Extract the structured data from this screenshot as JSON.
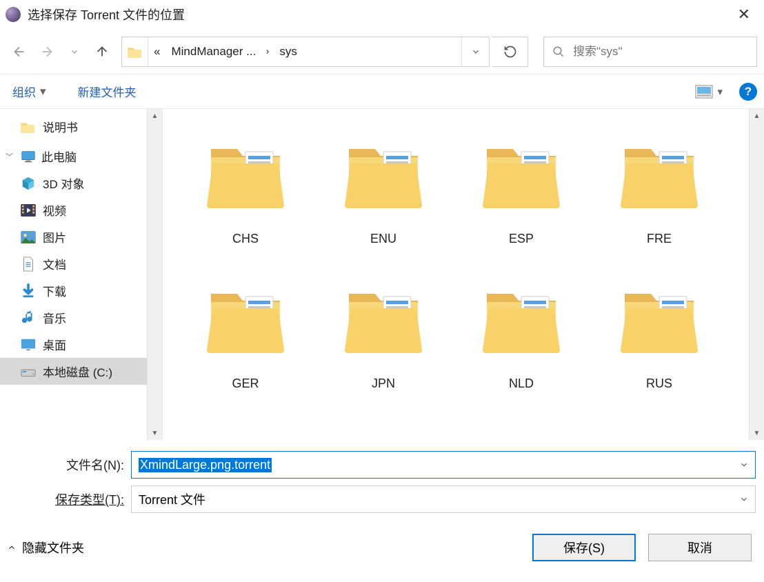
{
  "titlebar": {
    "title": "选择保存 Torrent 文件的位置"
  },
  "nav": {
    "breadcrumb": {
      "overflow": "«",
      "segments": [
        "MindManager ...",
        "sys"
      ]
    },
    "search_placeholder": "搜索\"sys\""
  },
  "toolbar": {
    "organize": "组织",
    "new_folder": "新建文件夹"
  },
  "sidebar": {
    "items": [
      {
        "label": "说明书",
        "icon": "folder",
        "indent": "child"
      },
      {
        "label": "此电脑",
        "icon": "computer",
        "indent": "section",
        "expandable": true
      },
      {
        "label": "3D 对象",
        "icon": "3d",
        "indent": "child"
      },
      {
        "label": "视频",
        "icon": "video",
        "indent": "child"
      },
      {
        "label": "图片",
        "icon": "pictures",
        "indent": "child"
      },
      {
        "label": "文档",
        "icon": "documents",
        "indent": "child"
      },
      {
        "label": "下载",
        "icon": "downloads",
        "indent": "child"
      },
      {
        "label": "音乐",
        "icon": "music",
        "indent": "child"
      },
      {
        "label": "桌面",
        "icon": "desktop",
        "indent": "child"
      },
      {
        "label": "本地磁盘 (C:)",
        "icon": "drive",
        "indent": "child",
        "selected": true
      }
    ]
  },
  "content": {
    "folders": [
      "CHS",
      "ENU",
      "ESP",
      "FRE",
      "GER",
      "JPN",
      "NLD",
      "RUS"
    ]
  },
  "form": {
    "filename_label": "文件名(N):",
    "filename_value": "XmindLarge.png.torrent",
    "type_label": "保存类型(T):",
    "type_value": "Torrent 文件"
  },
  "footer": {
    "hide_folders": "隐藏文件夹",
    "save": "保存(S)",
    "cancel": "取消"
  }
}
